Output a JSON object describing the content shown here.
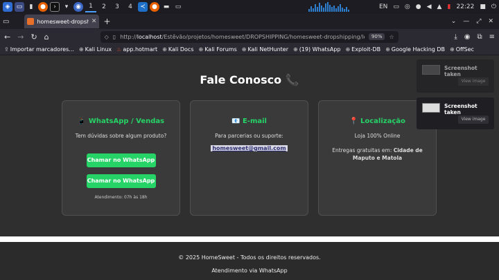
{
  "taskbar": {
    "workspaces": [
      "1",
      "2",
      "3",
      "4"
    ],
    "lang": "EN",
    "clock": "22:22"
  },
  "browser": {
    "tab_title": "homesweet-dropshipping",
    "url_prefix": "http://",
    "url_host": "localhost",
    "url_path": "/Estêvão/projetos/homesweet/DROPSHIPPING/homesweet-dropshipping/loja.html",
    "zoom": "90%"
  },
  "bookmarks": [
    {
      "label": "Importar marcadores..."
    },
    {
      "label": "Kali Linux"
    },
    {
      "label": "app.hotmart"
    },
    {
      "label": "Kali Docs"
    },
    {
      "label": "Kali Forums"
    },
    {
      "label": "Kali NetHunter"
    },
    {
      "label": "(19) WhatsApp"
    },
    {
      "label": "Exploit-DB"
    },
    {
      "label": "Google Hacking DB"
    },
    {
      "label": "OffSec"
    }
  ],
  "page": {
    "title": "Fale Conosco 📞",
    "whatsapp_card": {
      "title": "📱 WhatsApp / Vendas",
      "text": "Tem dúvidas sobre algum produto?",
      "button1": "Chamar no WhatsApp",
      "button2": "Chamar no WhatsApp",
      "hours": "Atendimento: 07h às 18h"
    },
    "email_card": {
      "title": "📧 E-mail",
      "text": "Para parcerias ou suporte:",
      "email": "homesweet@gmail.com"
    },
    "location_card": {
      "title": "📍 Localização",
      "text1": "Loja 100% Online",
      "text2_prefix": "Entregas gratuitas em: ",
      "text2_bold": "Cidade de Maputo e Matola"
    }
  },
  "notifications": [
    {
      "title": "Screenshot taken",
      "action": "View image"
    },
    {
      "title": "Screenshot taken",
      "action": "View image"
    }
  ],
  "footer": {
    "copyright": "© 2025 HomeSweet - Todos os direitos reservados.",
    "note": "Atendimento via WhatsApp"
  }
}
